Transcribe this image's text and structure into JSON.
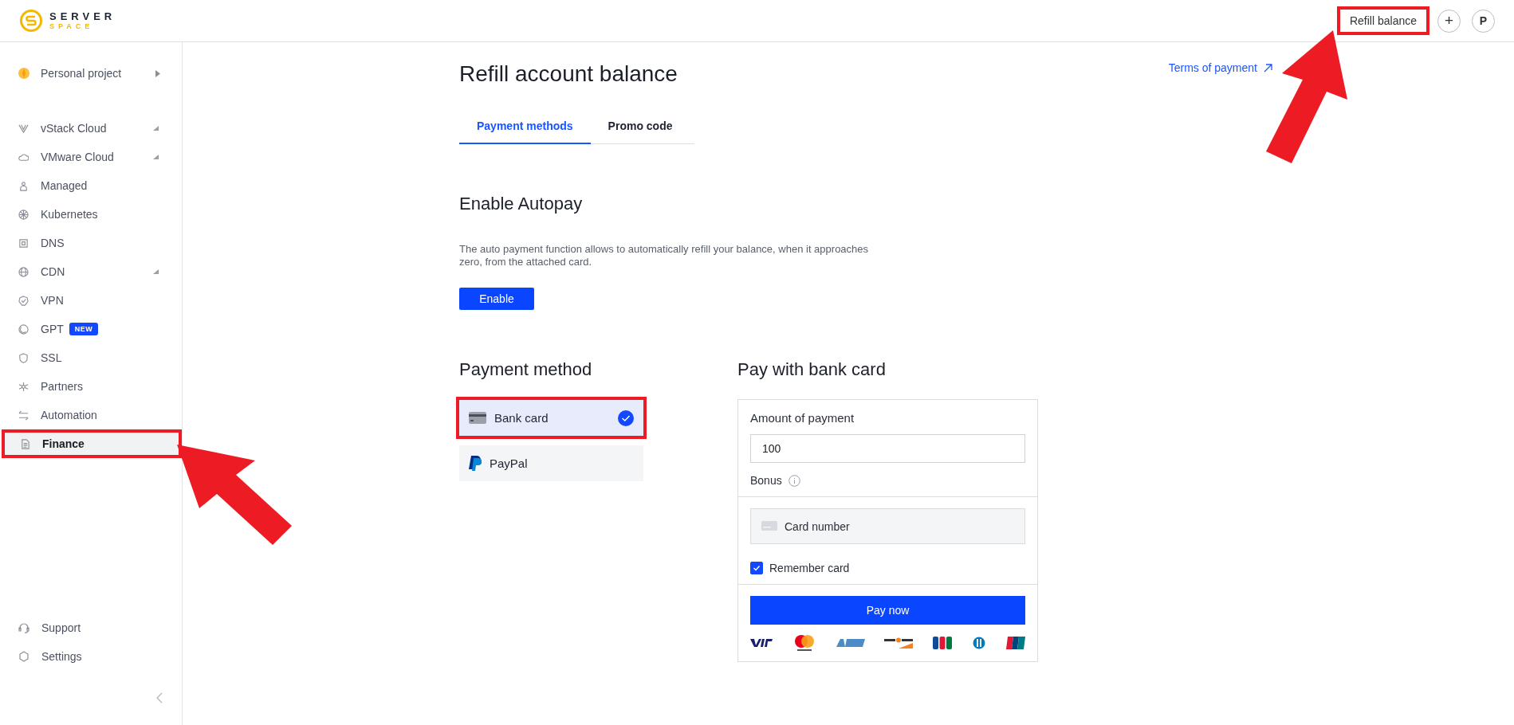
{
  "header": {
    "logo": {
      "top": "SERVER",
      "bottom": "SPACE"
    },
    "refill_button": {
      "label": "Refill balance",
      "highlighted": true
    },
    "add_button": "+",
    "avatar": "P"
  },
  "sidebar": {
    "project": {
      "label": "Personal project"
    },
    "items": [
      {
        "label": "vStack Cloud",
        "expandable": true,
        "selected": false,
        "highlighted": false
      },
      {
        "label": "VMware Cloud",
        "expandable": true,
        "selected": false,
        "highlighted": false
      },
      {
        "label": "Managed",
        "expandable": false,
        "selected": false,
        "highlighted": false
      },
      {
        "label": "Kubernetes",
        "expandable": false,
        "selected": false,
        "highlighted": false
      },
      {
        "label": "DNS",
        "expandable": false,
        "selected": false,
        "highlighted": false
      },
      {
        "label": "CDN",
        "expandable": true,
        "selected": false,
        "highlighted": false
      },
      {
        "label": "VPN",
        "expandable": false,
        "selected": false,
        "highlighted": false
      },
      {
        "label": "GPT",
        "badge": "NEW",
        "expandable": false,
        "selected": false,
        "highlighted": false
      },
      {
        "label": "SSL",
        "expandable": false,
        "selected": false,
        "highlighted": false
      },
      {
        "label": "Partners",
        "expandable": false,
        "selected": false,
        "highlighted": false
      },
      {
        "label": "Automation",
        "expandable": false,
        "selected": false,
        "highlighted": false
      },
      {
        "label": "Finance",
        "expandable": false,
        "selected": true,
        "highlighted": true
      }
    ],
    "bottom_items": [
      {
        "label": "Support"
      },
      {
        "label": "Settings"
      }
    ]
  },
  "page": {
    "title": "Refill account balance",
    "terms_link": "Terms of payment",
    "tabs": [
      {
        "label": "Payment methods",
        "selected": true
      },
      {
        "label": "Promo code",
        "selected": false
      }
    ],
    "autopay": {
      "heading": "Enable Autopay",
      "text": "The auto payment function allows to automatically refill your balance, when it approaches zero, from the attached card.",
      "button": "Enable"
    },
    "payment_method": {
      "heading": "Payment method",
      "methods": [
        {
          "kind": "card",
          "label": "Bank card",
          "selected": true,
          "highlighted": true
        },
        {
          "kind": "paypal",
          "label": "PayPal",
          "selected": false,
          "highlighted": false
        }
      ]
    },
    "card_form": {
      "heading": "Pay with bank card",
      "amount_label": "Amount of payment",
      "amount_value": "100",
      "bonus_label": "Bonus",
      "card_placeholder": "Card number",
      "remember": {
        "label": "Remember card",
        "checked": true
      },
      "pay_button": "Pay now"
    }
  }
}
